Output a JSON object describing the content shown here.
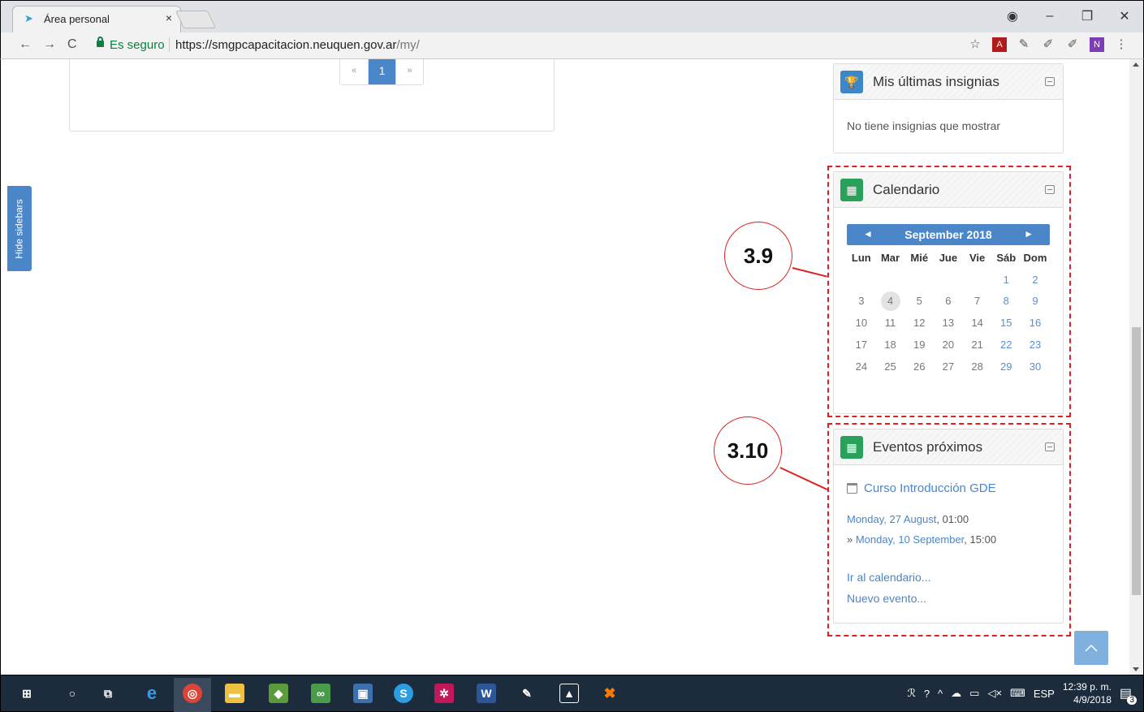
{
  "browser": {
    "tab_title": "Área personal",
    "tab_close": "×",
    "secure_label": "Es seguro",
    "url_scheme_host": "https://smgpcapacitacion.neuquen.gov.ar",
    "url_path": "/my/",
    "back": "←",
    "forward": "→",
    "reload": "C",
    "window_controls": [
      "–",
      "❐",
      "✕"
    ]
  },
  "pagination": {
    "prev": "«",
    "current": "1",
    "next": "»"
  },
  "hide_sidebars_label": "Hide sidebars",
  "badges_block": {
    "title": "Mis últimas insignias",
    "empty_message": "No tiene insignias que mostrar"
  },
  "calendar_block": {
    "title": "Calendario",
    "month": "September 2018",
    "prev": "◄",
    "next": "►",
    "weekdays": [
      "Lun",
      "Mar",
      "Mié",
      "Jue",
      "Vie",
      "Sáb",
      "Dom"
    ],
    "weeks": [
      [
        "",
        "",
        "",
        "",
        "",
        "1",
        "2"
      ],
      [
        "3",
        "4",
        "5",
        "6",
        "7",
        "8",
        "9"
      ],
      [
        "10",
        "11",
        "12",
        "13",
        "14",
        "15",
        "16"
      ],
      [
        "17",
        "18",
        "19",
        "20",
        "21",
        "22",
        "23"
      ],
      [
        "24",
        "25",
        "26",
        "27",
        "28",
        "29",
        "30"
      ]
    ],
    "today": "4"
  },
  "events_block": {
    "title": "Eventos próximos",
    "event_title": "Curso Introducción GDE",
    "start_link": "Monday, 27 August",
    "start_time": ", 01:00",
    "end_prefix": "» ",
    "end_link": "Monday, 10 September",
    "end_time": ", 15:00",
    "goto_calendar": "Ir al calendario...",
    "new_event": "Nuevo evento..."
  },
  "annotations": {
    "calendar_label": "3.9",
    "events_label": "3.10"
  },
  "back_to_top": "^",
  "taskbar": {
    "language": "ESP",
    "time": "12:39 p. m.",
    "date": "4/9/2018",
    "notification_count": "3"
  },
  "colors": {
    "accent": "#4a86c8",
    "annotation": "#e02020",
    "badge_icon": "#3b87c9",
    "calendar_icon": "#2aa15a"
  }
}
